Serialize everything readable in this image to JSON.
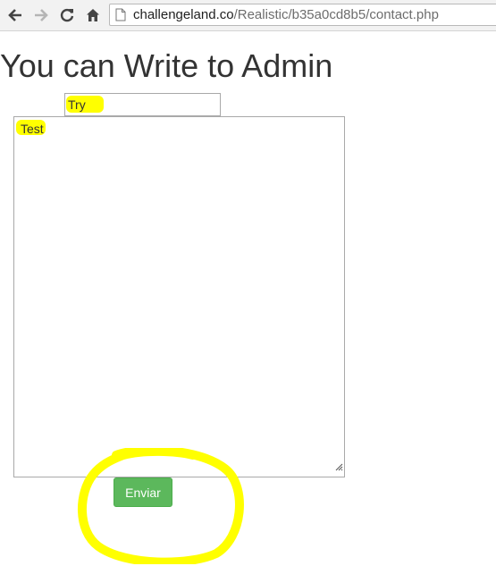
{
  "browser": {
    "url_host": "challengeland.co",
    "url_path": "/Realistic/b35a0cd8b5/contact.php",
    "icons": [
      "back-arrow-icon",
      "forward-arrow-icon",
      "reload-icon",
      "home-icon",
      "page-icon"
    ]
  },
  "page": {
    "heading": "You can Write to Admin"
  },
  "form": {
    "subject_value": "Try",
    "message_value": "Test",
    "submit_label": "Enviar"
  },
  "colors": {
    "highlight": "#ffff00",
    "button": "#5cb85c"
  }
}
